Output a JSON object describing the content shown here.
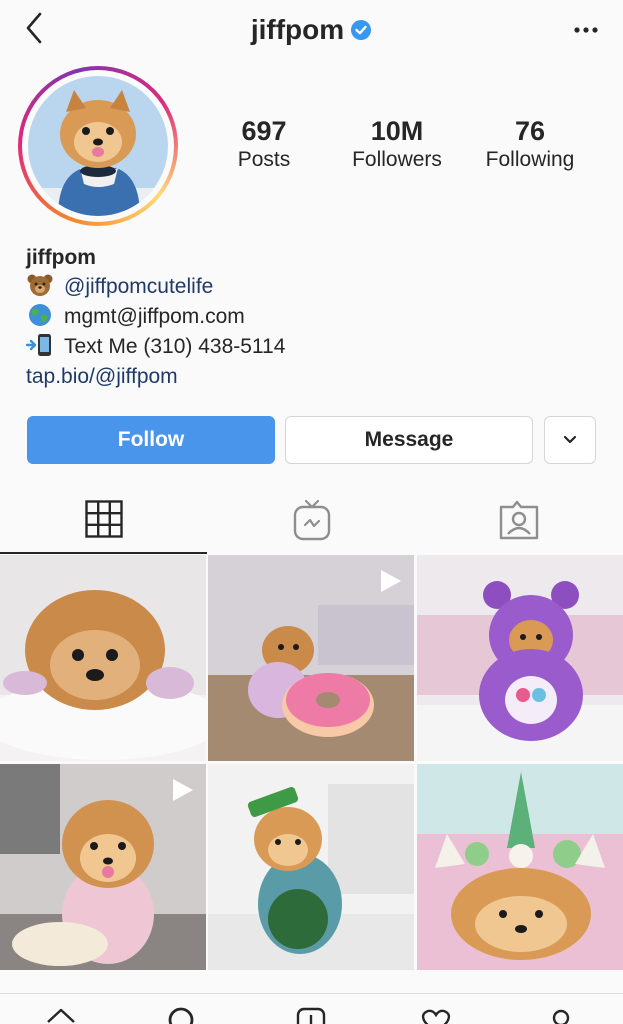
{
  "header": {
    "username": "jiffpom",
    "back_icon": "chevron-left-icon",
    "more_icon": "more-horizontal-icon",
    "verified_icon": "verified-badge-icon"
  },
  "stats": [
    {
      "value": "697",
      "label": "Posts"
    },
    {
      "value": "10M",
      "label": "Followers"
    },
    {
      "value": "76",
      "label": "Following"
    }
  ],
  "bio": {
    "name": "jiffpom",
    "lines": [
      {
        "emoji": "bear-emoji",
        "text": "@jiffpomcutelife"
      },
      {
        "emoji": "globe-emoji",
        "text": "mgmt@jiffpom.com"
      },
      {
        "emoji": "phone-emoji",
        "text": "Text Me (310) 438-5114"
      }
    ],
    "website": "tap.bio/@jiffpom"
  },
  "actions": {
    "follow": "Follow",
    "message": "Message",
    "dropdown_icon": "chevron-down-icon"
  },
  "tabs": [
    {
      "icon": "grid-icon",
      "active": true
    },
    {
      "icon": "igtv-icon",
      "active": false
    },
    {
      "icon": "tagged-icon",
      "active": false
    }
  ],
  "posts": [
    {
      "type": "photo"
    },
    {
      "type": "video"
    },
    {
      "type": "photo"
    },
    {
      "type": "photo"
    },
    {
      "type": "photo"
    },
    {
      "type": "photo"
    }
  ],
  "bottom_nav": [
    "home-icon",
    "search-icon",
    "new-post-icon",
    "activity-icon",
    "profile-icon"
  ],
  "colors": {
    "accent": "#4a95ec",
    "link": "#1f3a68",
    "text": "#262626",
    "background": "#fafafa"
  }
}
